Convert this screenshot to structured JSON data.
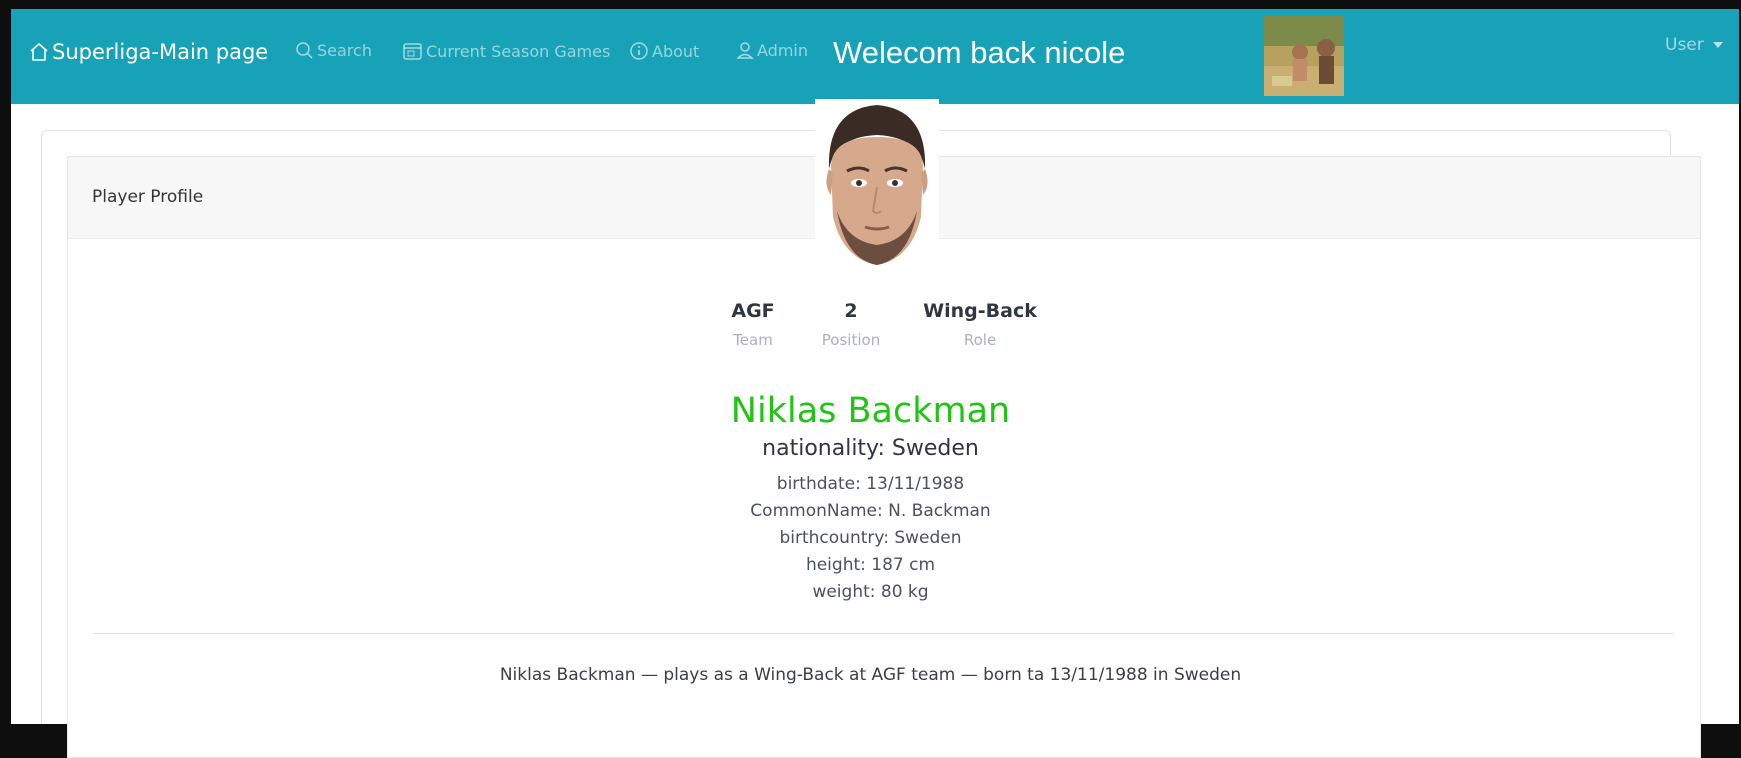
{
  "navbar": {
    "brand_label": "Superliga-Main page",
    "links": [
      {
        "label": "Search",
        "icon": "search-icon"
      },
      {
        "label": "Current Season Games",
        "icon": "calendar-icon"
      },
      {
        "label": "About",
        "icon": "info-icon"
      },
      {
        "label": "Admin",
        "icon": "user-icon"
      }
    ],
    "welcome_text": "Welecom back nicole",
    "user_menu_label": "User",
    "background_color": "#17a2b8"
  },
  "card": {
    "header_title": "Player Profile"
  },
  "player": {
    "stats": [
      {
        "value": "AGF",
        "label": "Team"
      },
      {
        "value": "2",
        "label": "Position"
      },
      {
        "value": "Wing-Back",
        "label": "Role"
      }
    ],
    "name": "Niklas Backman",
    "name_color": "#22c414",
    "nationality": "nationality: Sweden",
    "details": [
      "birthdate: 13/11/1988",
      "CommonName: N. Backman",
      "birthcountry: Sweden",
      "height: 187 cm",
      "weight: 80 kg"
    ],
    "summary": "Niklas Backman — plays as a Wing-Back at AGF team — born ta 13/11/1988 in Sweden"
  }
}
